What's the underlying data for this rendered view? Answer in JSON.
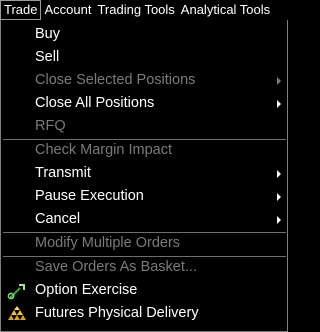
{
  "menubar": {
    "items": [
      {
        "label": "Trade",
        "mnemonic": "T"
      },
      {
        "label": "Account",
        "mnemonic": "A"
      },
      {
        "label": "Trading Tools",
        "mnemonic": "r"
      },
      {
        "label": "Analytical Tools",
        "mnemonic": "n"
      }
    ]
  },
  "menu": {
    "items": [
      {
        "label": "Buy",
        "enabled": true,
        "submenu": false
      },
      {
        "label": "Sell",
        "enabled": true,
        "submenu": false
      },
      {
        "label": "Close Selected Positions",
        "enabled": false,
        "submenu": true
      },
      {
        "label": "Close All Positions",
        "enabled": true,
        "submenu": true
      },
      {
        "label": "RFQ",
        "enabled": false,
        "submenu": false
      },
      {
        "label": "Check Margin Impact",
        "enabled": false,
        "submenu": false
      },
      {
        "label": "Transmit",
        "enabled": true,
        "submenu": true
      },
      {
        "label": "Pause Execution",
        "enabled": true,
        "submenu": true
      },
      {
        "label": "Cancel",
        "enabled": true,
        "submenu": true
      },
      {
        "label": "Modify Multiple Orders",
        "enabled": false,
        "submenu": false
      },
      {
        "label": "Save Orders As Basket...",
        "enabled": false,
        "submenu": false
      },
      {
        "label": "Option Exercise",
        "enabled": true,
        "submenu": false,
        "icon": "option-exercise-icon"
      },
      {
        "label": "Futures Physical Delivery",
        "enabled": true,
        "submenu": false,
        "icon": "futures-delivery-icon"
      }
    ]
  },
  "colors": {
    "background": "#000000",
    "text": "#ffffff",
    "disabled_text": "#7a7a7a",
    "separator": "#6f6f6f",
    "icon_green": "#3c9a3c",
    "icon_gold": "#e0a020"
  }
}
